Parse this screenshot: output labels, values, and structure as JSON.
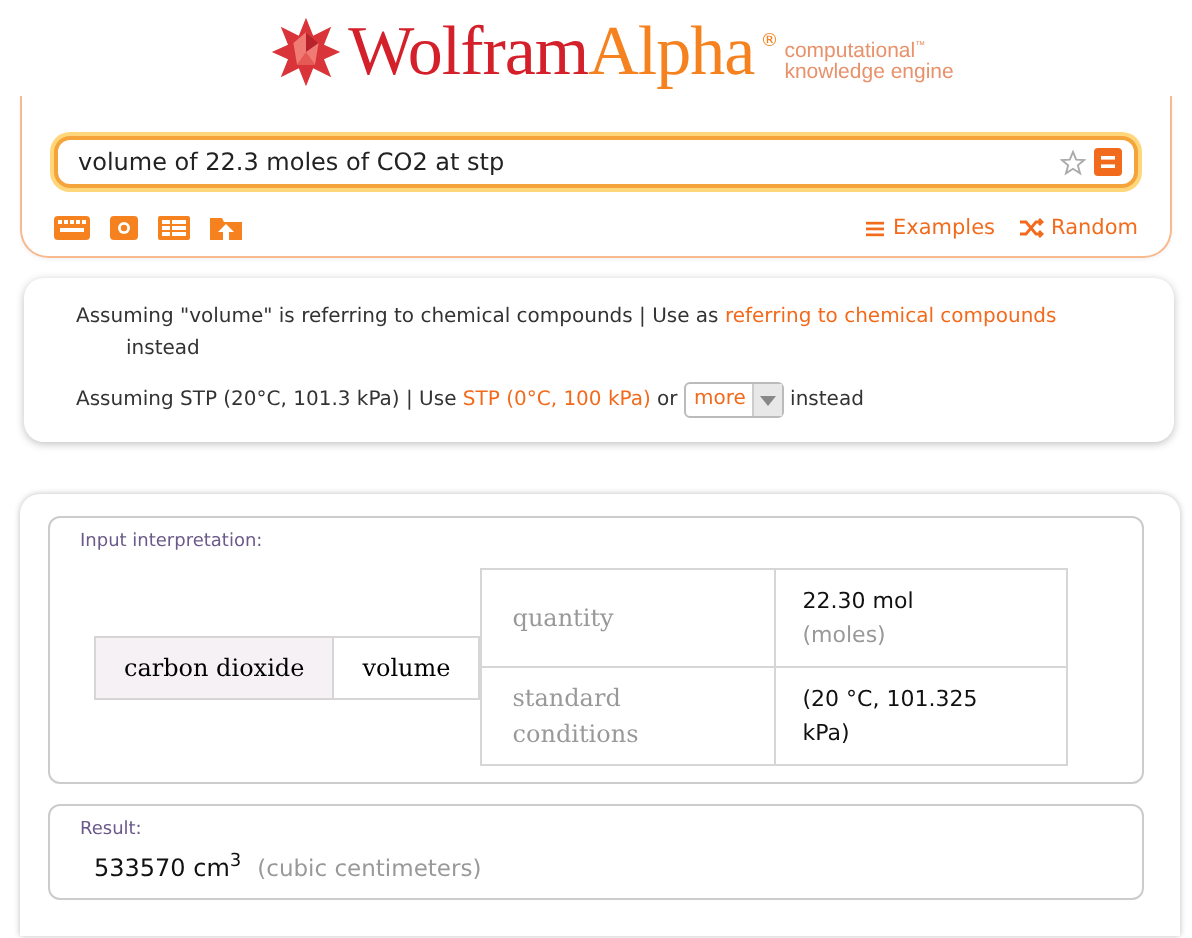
{
  "logo": {
    "word_1": "Wolfram",
    "word_2": "Alpha",
    "mark": "®",
    "tagline": [
      "computational$^{™}$",
      "knowledge engine"
    ]
  },
  "search": {
    "value": "volume of 22.3 moles of CO2 at stp"
  },
  "nav_links": [
    {
      "kind": "examples",
      "label": "Examples"
    },
    {
      "kind": "random",
      "label": "Random"
    }
  ],
  "assumptions": [
    [
      {
        "kind": "text",
        "text": "Assuming \"volume\" is referring to chemical compounds | Use as "
      },
      {
        "kind": "link",
        "text": "referring to chemical compounds"
      },
      {
        "kind": "text",
        "text": " instead"
      }
    ],
    [
      {
        "kind": "text",
        "text": "Assuming STP (20°C, 101.3 kPa) | Use "
      },
      {
        "kind": "link",
        "text": "STP (0°C, 100 kPa)"
      },
      {
        "kind": "text",
        "text": " or "
      },
      {
        "kind": "dropdown",
        "text": "more"
      },
      {
        "kind": "text",
        "text": " instead"
      }
    ]
  ],
  "pods": [
    {
      "kind": "table",
      "title": "Input interpretation:",
      "entity": "carbon dioxide",
      "property": "volume",
      "rows": [
        {
          "label": "quantity",
          "value": "22.30 mol",
          "unit": "(moles)"
        },
        {
          "label": "standard conditions",
          "value": "(20 °C, 101.325 kPa)"
        }
      ]
    },
    {
      "kind": "result",
      "title": "Result:",
      "value": "533570 cm$^{3}$",
      "unit": "(cubic centimeters)"
    }
  ]
}
